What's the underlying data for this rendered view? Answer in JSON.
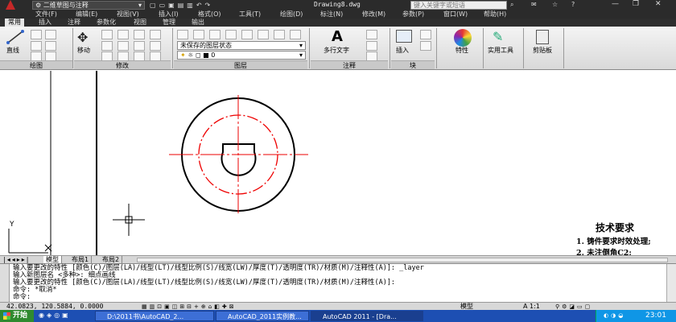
{
  "titlebar": {
    "workspace": "二维草图与注释",
    "filename": "Drawing8.dwg",
    "search_placeholder": "键入关键字或短语"
  },
  "menu": [
    "文件(F)",
    "编辑(E)",
    "视图(V)",
    "插入(I)",
    "格式(O)",
    "工具(T)",
    "绘图(D)",
    "标注(N)",
    "修改(M)",
    "参数(P)",
    "窗口(W)",
    "帮助(H)"
  ],
  "ribbon_tabs": [
    "常用",
    "插入",
    "注释",
    "参数化",
    "视图",
    "管理",
    "输出"
  ],
  "ribbon": {
    "draw_line_label": "直线",
    "move_label": "移动",
    "layer_state": "未保存的图层状态",
    "layer_current": "0",
    "multiline_text_label": "多行文字",
    "insert_label": "插入",
    "properties_label": "特性",
    "utilities_label": "实用工具",
    "clipboard_label": "剪贴板",
    "panels": [
      "绘图",
      "修改",
      "图层",
      "注释",
      "块"
    ]
  },
  "drawing": {
    "tech_title": "技术要求",
    "tech_items": [
      "1. 铸件要求时效处理;",
      "2. 未注倒角C2;"
    ],
    "ucs_y": "Y",
    "ucs_x": "X",
    "colors": {
      "outline": "#000000",
      "center": "#ff0000"
    }
  },
  "layout_tabs": [
    "模型",
    "布局1",
    "布局2"
  ],
  "command_lines": [
    "输入要更改的特性 [颜色(C)/图层(LA)/线型(LT)/线型比例(S)/线宽(LW)/厚度(T)/透明度(TR)/材质(M)/注释性(A)]: _layer",
    "输入新图层名 <多种>: 细点画线",
    "输入要更改的特性 [颜色(C)/图层(LA)/线型(LT)/线型比例(S)/线宽(LW)/厚度(T)/透明度(TR)/材质(M)/注释性(A)]:",
    "命令: *取消*",
    "命令:"
  ],
  "status": {
    "coords": "42.0823,  120.5884, 0.0000",
    "model": "模型",
    "scale": "A 1:1"
  },
  "taskbar": {
    "start": "开始",
    "items": [
      "D:\\2011书\\AutoCAD_2...",
      "AutoCAD_2011实例教...",
      "AutoCAD 2011 - [Dra..."
    ],
    "clock": "23:01"
  }
}
